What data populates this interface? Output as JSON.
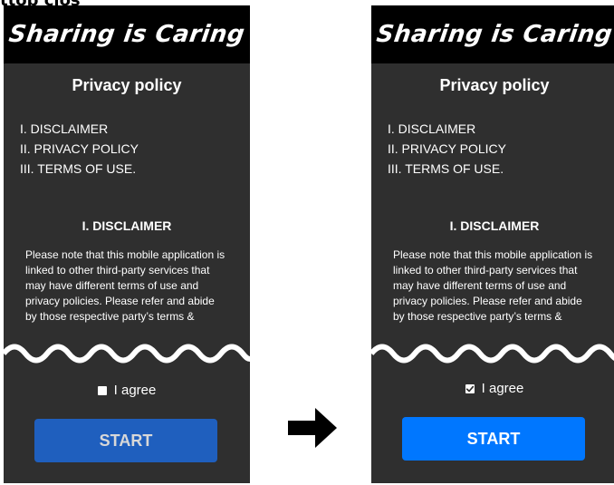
{
  "colors": {
    "phone_background": "#2f2f2f",
    "header_background": "#000000",
    "disabled_button": "#1f5fbe",
    "enabled_button": "#0077ff",
    "text": "#ffffff"
  },
  "top_caption": "ttop clos",
  "left_screen": {
    "app_title": "Sharing is Caring",
    "policy_title": "Privacy policy",
    "toc": [
      {
        "label": "I. DISCLAIMER"
      },
      {
        "label": "II. PRIVACY POLICY"
      },
      {
        "label": "III. TERMS OF USE."
      }
    ],
    "section_title": "I. DISCLAIMER",
    "disclaimer_text": "Please note that this mobile application is linked to other third-party services that may have different terms of use and privacy policies. Please refer and abide by those respective party’s terms &",
    "agree_label": "I agree",
    "agree_checked": false,
    "start_label": "START"
  },
  "right_screen": {
    "app_title": "Sharing is Caring",
    "policy_title": "Privacy policy",
    "toc": [
      {
        "label": "I. DISCLAIMER"
      },
      {
        "label": "II. PRIVACY POLICY"
      },
      {
        "label": "III. TERMS OF USE."
      }
    ],
    "section_title": "I. DISCLAIMER",
    "disclaimer_text": "Please note that this mobile application is linked to other third-party services that may have different terms of use and privacy policies. Please refer and abide by those respective party’s terms &",
    "agree_label": "I agree",
    "agree_checked": true,
    "start_label": "START"
  },
  "icons": {
    "arrow": "right-arrow-icon",
    "checkbox": "checkbox-icon",
    "wave": "torn-edge-icon"
  }
}
